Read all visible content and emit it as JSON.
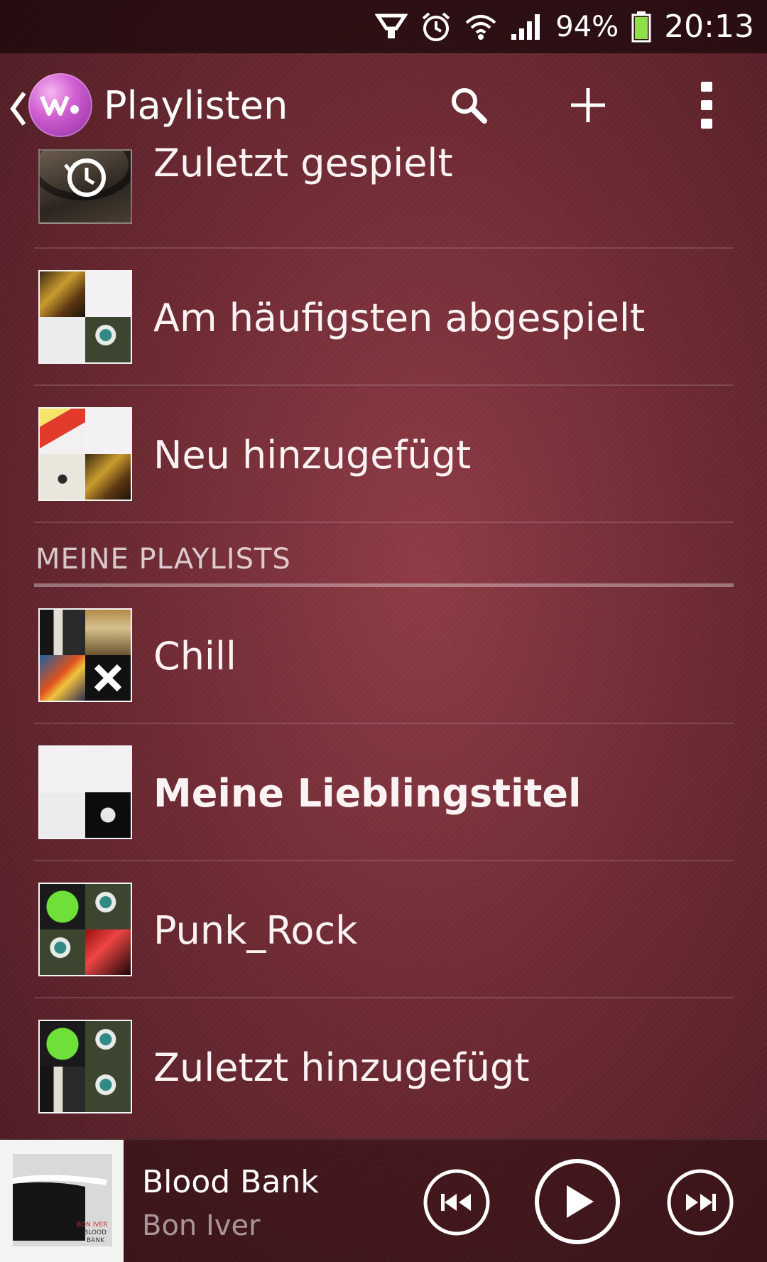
{
  "status_bar": {
    "battery_percent": "94%",
    "time": "20:13",
    "icons": [
      "fieldtest-icon",
      "alarm-icon",
      "wifi-icon",
      "signal-icon",
      "battery-icon"
    ],
    "battery_color": "#8ee04a"
  },
  "app_bar": {
    "title": "Playlisten",
    "back_icon": "chevron-left-icon",
    "logo_icon": "walkman-icon",
    "actions": [
      "search-icon",
      "add-icon",
      "overflow-menu-icon"
    ]
  },
  "smart_playlists": [
    {
      "label": "Zuletzt gespielt",
      "thumb": "recently-played-turntable"
    },
    {
      "label": "Am häufigsten abgespielt",
      "thumb": "album-grid"
    },
    {
      "label": "Neu hinzugefügt",
      "thumb": "album-grid"
    }
  ],
  "section_header": "MEINE PLAYLISTS",
  "my_playlists": [
    {
      "label": "Chill",
      "bold": false,
      "thumb": "album-grid"
    },
    {
      "label": "Meine Lieblingstitel",
      "bold": true,
      "thumb": "album-grid"
    },
    {
      "label": "Punk_Rock",
      "bold": false,
      "thumb": "album-grid"
    },
    {
      "label": "Zuletzt hinzugefügt",
      "bold": false,
      "thumb": "album-grid"
    }
  ],
  "now_playing": {
    "title": "Blood Bank",
    "artist": "Bon Iver",
    "art_text": [
      "BON IVER",
      "BLOOD",
      "BANK"
    ],
    "controls": [
      "previous-icon",
      "play-icon",
      "next-icon"
    ]
  },
  "colors": {
    "background": "#7a2f38",
    "text": "#ffffff",
    "secondary_text": "rgba(255,255,255,0.55)"
  }
}
